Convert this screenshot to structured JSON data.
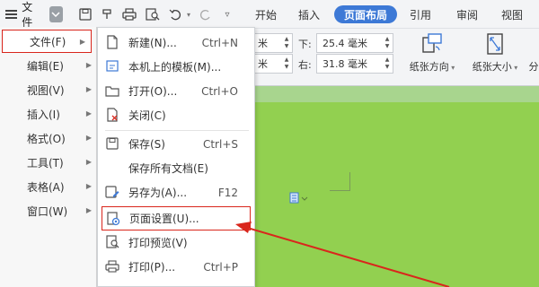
{
  "topbar": {
    "file_label": "文件",
    "tabs": [
      "开始",
      "插入",
      "页面布局",
      "引用",
      "审阅",
      "视图"
    ],
    "active_tab": "页面布局"
  },
  "ribbon": {
    "margin_top_value": "米",
    "margin_bottom_label": "下:",
    "margin_bottom_value": "25.4 毫米",
    "margin_left_value": "米",
    "margin_right_label": "右:",
    "margin_right_value": "31.8 毫米",
    "orientation_label": "纸张方向",
    "paper_size_label": "纸张大小",
    "columns_label": "分"
  },
  "left_menu": {
    "items": [
      {
        "label": "文件(F)"
      },
      {
        "label": "编辑(E)"
      },
      {
        "label": "视图(V)"
      },
      {
        "label": "插入(I)"
      },
      {
        "label": "格式(O)"
      },
      {
        "label": "工具(T)"
      },
      {
        "label": "表格(A)"
      },
      {
        "label": "窗口(W)"
      }
    ]
  },
  "sub_menu": {
    "items": [
      {
        "label": "新建(N)...",
        "shortcut": "Ctrl+N",
        "icon": "new-doc-icon"
      },
      {
        "label": "本机上的模板(M)...",
        "shortcut": "",
        "icon": "template-icon"
      },
      {
        "label": "打开(O)...",
        "shortcut": "Ctrl+O",
        "icon": "folder-icon"
      },
      {
        "label": "关闭(C)",
        "shortcut": "",
        "icon": "close-doc-icon"
      },
      {
        "label": "保存(S)",
        "shortcut": "Ctrl+S",
        "icon": "save-icon"
      },
      {
        "label": "保存所有文档(E)",
        "shortcut": "",
        "icon": ""
      },
      {
        "label": "另存为(A)...",
        "shortcut": "F12",
        "icon": "save-as-icon"
      },
      {
        "label": "页面设置(U)...",
        "shortcut": "",
        "icon": "page-setup-icon"
      },
      {
        "label": "打印预览(V)",
        "shortcut": "",
        "icon": "print-preview-icon"
      },
      {
        "label": "打印(P)...",
        "shortcut": "Ctrl+P",
        "icon": "print-icon"
      }
    ]
  },
  "colors": {
    "accent": "#3d79d6",
    "highlight_border": "#d9261c",
    "document_green": "#92d050"
  }
}
